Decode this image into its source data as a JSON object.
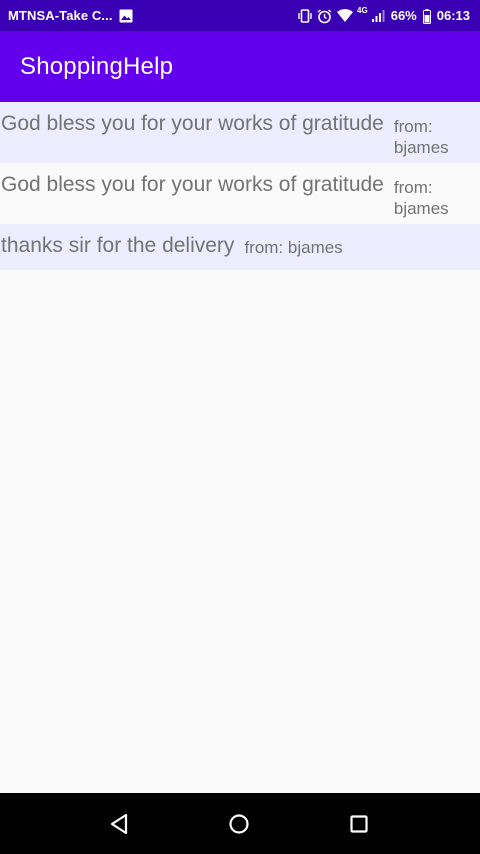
{
  "status_bar": {
    "carrier": "MTNSA-Take C...",
    "network_type": "4G",
    "battery_percent": "66%",
    "time": "06:13",
    "icons": [
      "image-icon",
      "vibrate-icon",
      "alarm-icon",
      "wifi-icon",
      "signal-icon",
      "battery-icon"
    ]
  },
  "app_bar": {
    "title": "ShoppingHelp",
    "color": "#6200ee"
  },
  "messages": [
    {
      "text": "God bless you for your works of gratitude",
      "from": "from: bjames"
    },
    {
      "text": "God bless you for your works of gratitude",
      "from": "from: bjames"
    },
    {
      "text": "thanks sir for the delivery",
      "from": "from: bjames"
    }
  ],
  "nav_bar": {
    "icons": [
      "back-icon",
      "home-icon",
      "recents-icon"
    ]
  }
}
